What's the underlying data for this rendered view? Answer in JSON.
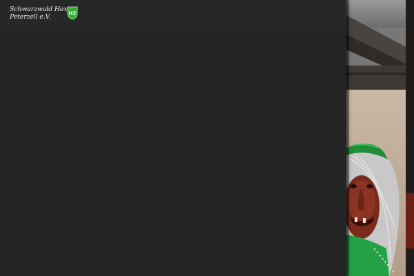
{
  "header": {
    "logo": {
      "line1": "Schwarzwald Hexen",
      "line2": "Peterzell e.V.",
      "crest_letters": "HZ",
      "crest_color": "#2fae2f"
    }
  },
  "colors": {
    "panel_background": "#242424",
    "header_background": "#272727",
    "text": "#e8e8e8"
  },
  "hero_image": {
    "subject": "witch-mask-with-green-hat"
  }
}
